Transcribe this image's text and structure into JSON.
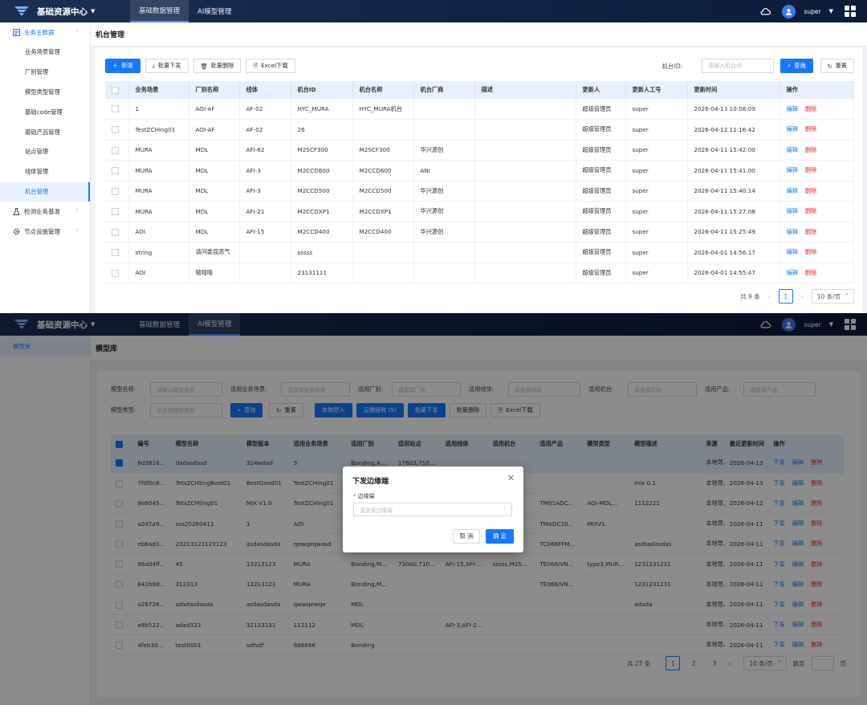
{
  "colors": {
    "accent": "#1677ff",
    "danger": "#f5222d",
    "header_bg": "#102446",
    "table_header_bg": "#e6f0ff"
  },
  "header": {
    "brand": "基础资源中心",
    "tabs": [
      "基础数据管理",
      "AI模型管理"
    ],
    "user": "super",
    "icons": [
      "cloud-icon",
      "user-icon",
      "apps-grid-icon"
    ]
  },
  "screen1": {
    "sidebar": {
      "group1": "业务主数据",
      "items": [
        "业务场景管理",
        "厂别管理",
        "模型类型管理",
        "基础code管理",
        "基础产品管理",
        "站点管理",
        "线体管理",
        "机台管理"
      ],
      "group2": "检测业务基准",
      "group3": "节点设施管理"
    },
    "page_title": "机台管理",
    "toolbar": {
      "add": "新增",
      "batch_issue": "批量下发",
      "batch_delete": "批量删除",
      "excel": "Excel下载"
    },
    "search": {
      "label": "机台ID:",
      "placeholder": "请输入机台ID",
      "query": "查询",
      "reset": "重置"
    },
    "table": {
      "headers": [
        "业务场景",
        "厂别名称",
        "线体",
        "机台ID",
        "机台名称",
        "机台厂商",
        "描述",
        "更新人",
        "更新人工号",
        "更新时间",
        "操作"
      ],
      "rows": [
        [
          "1",
          "AOI-AF",
          "AF-02",
          "HYC_MURA",
          "HYC_MURA机台",
          "",
          "",
          "超级管理员",
          "super",
          "2026-04-13 10:08:09"
        ],
        [
          "TestZCHing01",
          "AOI-AF",
          "AF-02",
          "26",
          "",
          "",
          "",
          "超级管理员",
          "super",
          "2026-04-12 11:16:42"
        ],
        [
          "MURA",
          "MDL",
          "AFI-62",
          "M2SCF300",
          "M2SCF300",
          "华兴源创",
          "",
          "超级管理员",
          "super",
          "2026-04-11 15:42:00"
        ],
        [
          "MURA",
          "MDL",
          "AFI-3",
          "M2CCD600",
          "M2CCD600",
          "ANI",
          "",
          "超级管理员",
          "super",
          "2026-04-11 15:41:00"
        ],
        [
          "MURA",
          "MDL",
          "AFI-3",
          "M2CCD500",
          "M2CCD500",
          "华兴源创",
          "",
          "超级管理员",
          "super",
          "2026-04-11 15:40:14"
        ],
        [
          "MURA",
          "MDL",
          "AFI-21",
          "M2CCDXP1",
          "M2CCDXP1",
          "华兴源创",
          "",
          "超级管理员",
          "super",
          "2026-04-11 15:27:08"
        ],
        [
          "AOI",
          "MDL",
          "AFI-15",
          "M2CCD400",
          "M2CCD400",
          "华兴源创",
          "",
          "超级管理员",
          "super",
          "2026-04-11 15:25:49"
        ],
        [
          "string",
          "请问委屈恶气",
          "",
          "sssss",
          "",
          "",
          "",
          "超级管理员",
          "super",
          "2026-04-01 14:56:17"
        ],
        [
          "AOI",
          "嘻嘻嘻",
          "",
          "23131111",
          "",
          "",
          "",
          "超级管理员",
          "super",
          "2026-04-01 14:55:47"
        ]
      ],
      "edit": "编辑",
      "delete": "删除"
    },
    "pager": {
      "total": "共 9 条",
      "page": "1",
      "size": "10 条/页"
    }
  },
  "screen2": {
    "sidebar_item": "模型库",
    "page_title": "模型库",
    "filters": {
      "model_name": {
        "label": "模型名称:",
        "placeholder": "请输入模型名称"
      },
      "scene": {
        "label": "适用业务场景:",
        "placeholder": "请选择业务场景"
      },
      "factory": {
        "label": "适用厂别:",
        "placeholder": "请选择厂别"
      },
      "line": {
        "label": "适用线体:",
        "placeholder": "请选择线体"
      },
      "machine": {
        "label": "适用机台:",
        "placeholder": "请选择机台"
      },
      "product": {
        "label": "适用产品:",
        "placeholder": "请选择产品"
      },
      "model_type": {
        "label": "模型类型:",
        "placeholder": "请选择模型类型"
      }
    },
    "buttons": {
      "query": "查询",
      "reset": "重置",
      "local_import": "本地导入",
      "cloud_receive": "云端接收 (5)",
      "batch_issue": "批量下发",
      "batch_delete": "批量删除",
      "excel": "Excel下载"
    },
    "table": {
      "headers": [
        "编号",
        "模型名称",
        "模型版本",
        "适用业务场景",
        "适用厂别",
        "适用站点",
        "适用线体",
        "适用机台",
        "适用产品",
        "模型类型",
        "模型描述",
        "来源",
        "最近更新时间",
        "操作"
      ],
      "rows": [
        [
          "6d3816...",
          "dadasdasd",
          "324wdad",
          "3",
          "Bonding,A...",
          "17603,710...",
          "",
          "",
          "",
          "",
          "",
          "本地导入",
          "2026-04-13"
        ],
        [
          "7fdf0c8...",
          "TetsZCHtingBest01",
          "BestGood01",
          "TestZCHing01",
          "",
          "",
          "",
          "",
          "",
          "",
          "mix 0.1",
          "本地导入",
          "2026-04-13"
        ],
        [
          "8e6045...",
          "TetsZCHting01",
          "MIX V1.0",
          "TestZCHing01",
          "",
          "",
          "",
          "",
          "TM01ADC...",
          "AOI-MDL...",
          "1112221",
          "本地导入",
          "2026-04-12"
        ],
        [
          "a2d7a9...",
          "sss20260411",
          "1",
          "AOI",
          "",
          "",
          "",
          "",
          "TMADC10...",
          "MIXV1",
          "",
          "本地导入",
          "2026-04-11"
        ],
        [
          "eb6ad3...",
          "23213123123123",
          "asdasdasda",
          "qewqeqwasd",
          "",
          "",
          "",
          "",
          "TC068FFM...",
          "",
          "asdsadasdas",
          "本地导入",
          "2026-04-11"
        ],
        [
          "96dd4ff...",
          "45",
          "13213123",
          "MURA",
          "Bonding,M...",
          "730A0,710...",
          "AFI-15,AFI-...",
          "sssss,M2S...",
          "TE066/VN...",
          "type3,MUR...",
          "1231231231",
          "本地导入",
          "2026-04-11"
        ],
        [
          "841b9d...",
          "312313",
          "13213123",
          "MURA",
          "Bonding,M...",
          "",
          "",
          "",
          "TE066/VN...",
          "",
          "1231231231",
          "本地导入",
          "2026-04-11"
        ],
        [
          "a28726...",
          "sdadasdasda",
          "asdasdasda",
          "qwwqewqe",
          "MDL",
          "",
          "",
          "",
          "",
          "",
          "adada",
          "本地导入",
          "2026-04-11"
        ],
        [
          "e8b522...",
          "adad323",
          "32133131",
          "112112",
          "MDL",
          "",
          "AFI-3,AFI-2...",
          "",
          "",
          "",
          "",
          "本地导入",
          "2026-04-11"
        ],
        [
          "4feb3d...",
          "test0001",
          "sdfsdf",
          "666666",
          "Bonding",
          "",
          "",
          "",
          "",
          "",
          "",
          "本地导入",
          "2026-04-11"
        ]
      ],
      "selected_row": 0,
      "actions": [
        "下发",
        "编辑",
        "删除"
      ]
    },
    "pager": {
      "total": "共 27 条",
      "pages": [
        "1",
        "2",
        "3"
      ],
      "size": "10 条/页",
      "goto": "跳至",
      "page_unit": "页"
    },
    "modal": {
      "title": "下发边缘端",
      "label": "边缘端",
      "placeholder": "请选择边缘端",
      "cancel": "取 消",
      "ok": "确 定"
    }
  }
}
